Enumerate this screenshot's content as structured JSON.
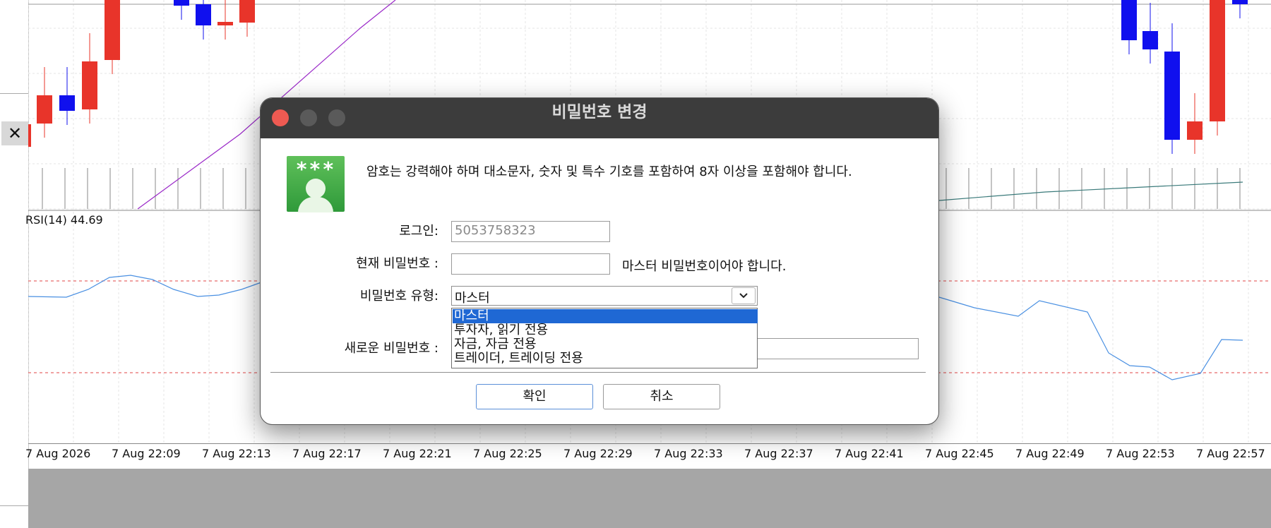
{
  "chart": {
    "rsi_label": "RSI(14) 44.69",
    "time_ticks": [
      "7 Aug 2026",
      "7 Aug 22:09",
      "7 Aug 22:13",
      "7 Aug 22:17",
      "7 Aug 22:21",
      "7 Aug 22:25",
      "7 Aug 22:29",
      "7 Aug 22:33",
      "7 Aug 22:37",
      "7 Aug 22:41",
      "7 Aug 22:45",
      "7 Aug 22:49",
      "7 Aug 22:53",
      "7 Aug 22:57"
    ],
    "colors": {
      "bull": "#e8342a",
      "bear": "#1010ee",
      "ma": "#9a28c8",
      "rsi": "#4a90e2",
      "rsi_levels": "#e04545"
    }
  },
  "dialog": {
    "title": "비밀번호 변경",
    "notice": "암호는 강력해야 하며 대소문자, 숫자 및 특수 기호를 포함하여 8자 이상을 포함해야 합니다.",
    "icon": {
      "stars": "***",
      "name": "user-password-icon"
    },
    "login_label": "로그인:",
    "login_value": "5053758323",
    "current_password_label": "현재 비밀번호 :",
    "current_password_hint": "마스터 비밀번호이어야 합니다.",
    "password_type_label": "비밀번호 유형:",
    "password_type_selected": "마스터",
    "password_type_options": [
      "마스터",
      "투자자, 읽기 전용",
      "자금, 자금 전용",
      "트레이더, 트레이딩 전용"
    ],
    "new_password_label": "새로운 비밀번호 :",
    "ok_label": "확인",
    "cancel_label": "취소"
  }
}
